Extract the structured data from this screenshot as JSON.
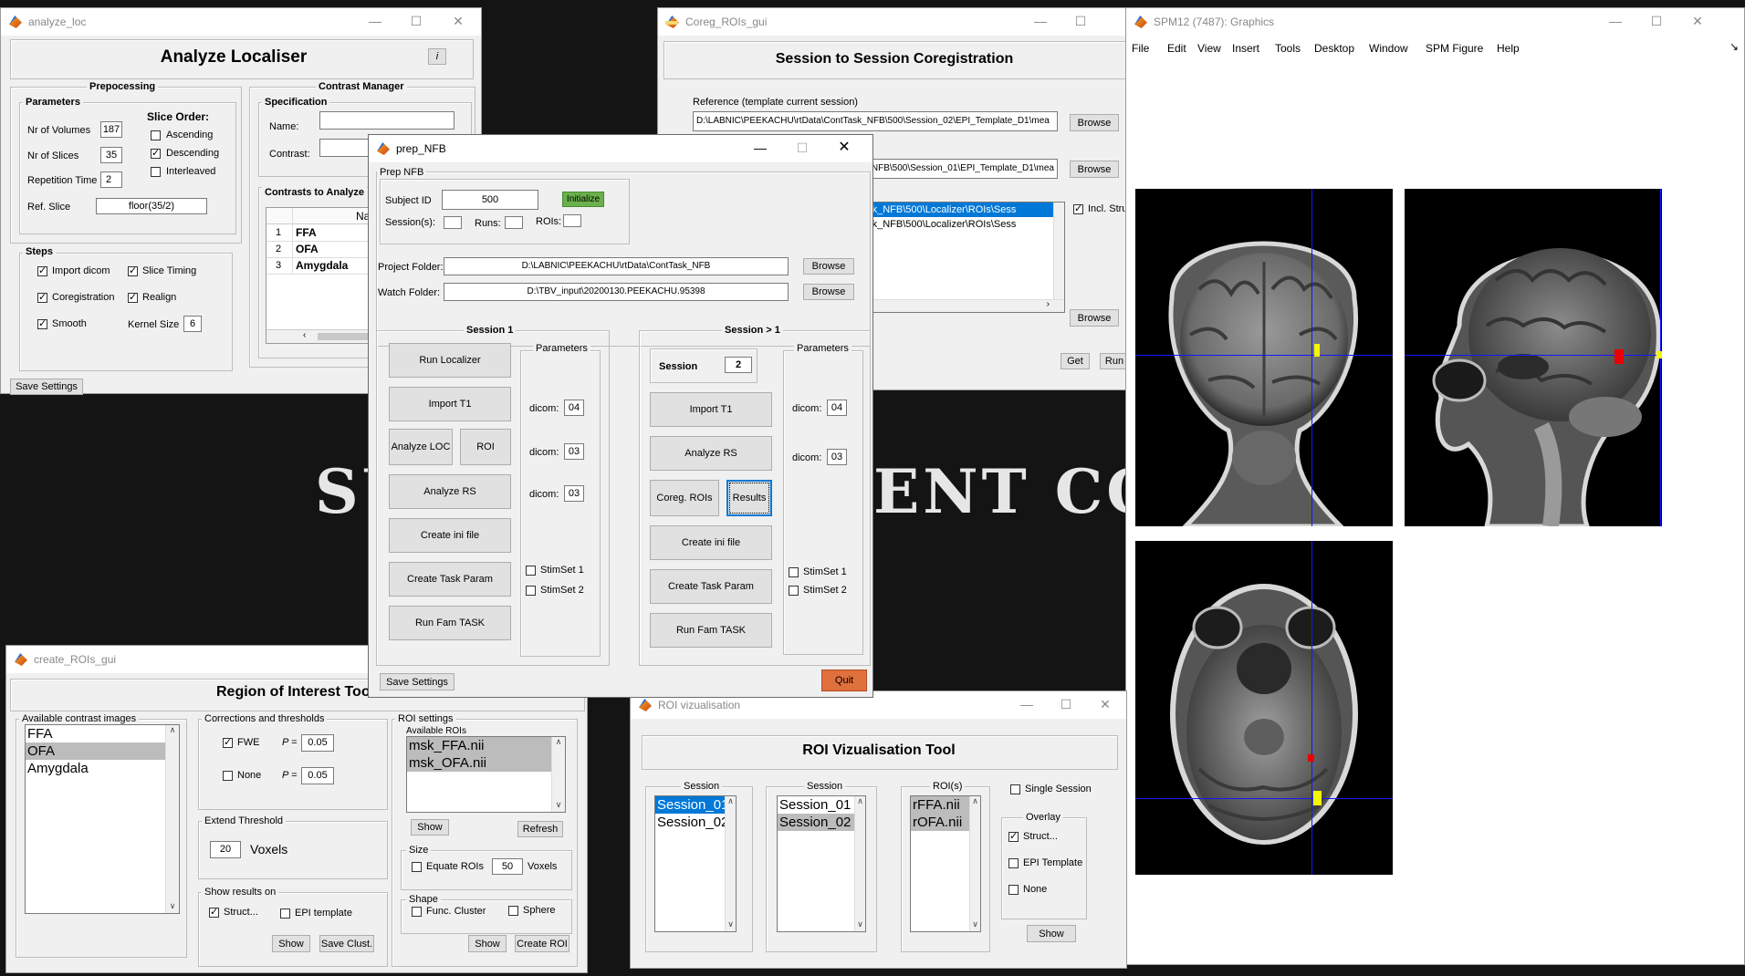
{
  "background_text": {
    "left": "SU",
    "right": "ENT CON"
  },
  "analyze_loc": {
    "window_title": "analyze_loc",
    "heading": "Analyze Localiser",
    "info_label": "i",
    "preprocessing": {
      "title": "Prepocessing",
      "parameters_title": "Parameters",
      "nr_volumes_label": "Nr of Volumes",
      "nr_volumes": "187",
      "nr_slices_label": "Nr of Slices",
      "nr_slices": "35",
      "tr_label": "Repetition Time",
      "tr": "2",
      "ref_slice_label": "Ref. Slice",
      "ref_slice": "floor(35/2)",
      "slice_order_title": "Slice Order:",
      "ascending": "Ascending",
      "descending": "Descending",
      "interleaved": "Interleaved"
    },
    "steps": {
      "title": "Steps",
      "import_dicom": "Import dicom",
      "slice_timing": "Slice Timing",
      "coregistration": "Coregistration",
      "realign": "Realign",
      "smooth": "Smooth",
      "kernel_size_label": "Kernel Size",
      "kernel_size": "6"
    },
    "contrast_manager": {
      "title": "Contrast Manager",
      "specification": "Specification",
      "name_label": "Name:",
      "contrast_label": "Contrast:",
      "table_title": "Contrasts to Analyze",
      "col_name": "Name",
      "rows": [
        {
          "n": "1",
          "name": "FFA"
        },
        {
          "n": "2",
          "name": "OFA"
        },
        {
          "n": "3",
          "name": "Amygdala"
        }
      ]
    },
    "save_settings": "Save Settings"
  },
  "coreg": {
    "window_title": "Coreg_ROIs_gui",
    "heading": "Session to Session Coregistration",
    "reference_label": "Reference (template current session)",
    "reference_path": "D:\\LABNIC\\PEEKACHU\\rtData\\ContTask_NFB\\500\\Session_02\\EPI_Template_D1\\mea",
    "second_path": "NFB\\500\\Session_01\\EPI_Template_D1\\mea",
    "browse": "Browse",
    "rois": [
      "ask_NFB\\500\\Localizer\\ROIs\\Sess",
      "ask_NFB\\500\\Localizer\\ROIs\\Sess"
    ],
    "incl_struct": "Incl. Stru",
    "get": "Get",
    "run": "Run"
  },
  "prep_nfb": {
    "window_title": "prep_NFB",
    "prep_title": "Prep NFB",
    "subject_id_label": "Subject ID",
    "subject_id": "500",
    "initialize": "Initialize",
    "sessions_label": "Session(s):",
    "runs_label": "Runs:",
    "rois_label": "ROIs:",
    "project_folder_label": "Project Folder:",
    "project_folder": "D:\\LABNIC\\PEEKACHU\\rtData\\ContTask_NFB",
    "watch_folder_label": "Watch Folder:",
    "watch_folder": "D:\\TBV_input\\20200130.PEEKACHU.95398",
    "browse": "Browse",
    "session1": {
      "title": "Session 1",
      "run_localizer": "Run Localizer",
      "import_t1": "Import T1",
      "analyze_loc": "Analyze LOC",
      "roi": "ROI",
      "analyze_rs": "Analyze RS",
      "create_ini": "Create ini file",
      "create_task_param": "Create Task Param",
      "run_fam_task": "Run Fam TASK",
      "params_title": "Parameters",
      "dicom_label": "dicom:",
      "dicom1": "04",
      "dicom2": "03",
      "dicom3": "03",
      "stimset1": "StimSet 1",
      "stimset2": "StimSet 2"
    },
    "session_gt1": {
      "title": "Session > 1",
      "session_label": "Session",
      "session_value": "2",
      "import_t1": "Import T1",
      "analyze_rs": "Analyze RS",
      "coreg_rois": "Coreg. ROIs",
      "results": "Results",
      "create_ini": "Create ini file",
      "create_task_param": "Create Task Param",
      "run_fam_task": "Run Fam TASK",
      "params_title": "Parameters",
      "dicom_label": "dicom:",
      "dicom1": "04",
      "dicom2": "03",
      "stimset1": "StimSet 1",
      "stimset2": "StimSet 2"
    },
    "save_settings": "Save Settings",
    "quit": "Quit",
    "colors": {
      "initialize": "#6ab04c",
      "quit": "#e0703c"
    }
  },
  "create_rois": {
    "window_title": "create_ROIs_gui",
    "heading": "Region of Interest Too",
    "available_contrasts_title": "Available contrast images",
    "contrasts": [
      "FFA",
      "OFA",
      "Amygdala"
    ],
    "corrections_title": "Corrections and thresholds",
    "fwe": "FWE",
    "none": "None",
    "p_label": "P =",
    "p_fwe": "0.05",
    "p_none": "0.05",
    "extend_title": "Extend Threshold",
    "extend_value": "20",
    "voxels": "Voxels",
    "show_results_title": "Show results on",
    "struct": "Struct...",
    "epi_template": "EPI template",
    "show": "Show",
    "save_clust": "Save Clust.",
    "roi_settings_title": "ROI settings",
    "available_rois_title": "Available ROIs",
    "rois": [
      "msk_FFA.nii",
      "msk_OFA.nii"
    ],
    "refresh": "Refresh",
    "size_title": "Size",
    "equate_rois": "Equate ROIs",
    "size_value": "50",
    "size_voxels": "Voxels",
    "shape_title": "Shape",
    "func_cluster": "Func. Cluster",
    "sphere": "Sphere",
    "create_roi": "Create ROI"
  },
  "roi_viz": {
    "window_title": "ROI vizualisation",
    "heading": "ROI Vizualisation Tool",
    "session_title": "Session",
    "sessions_a": [
      "Session_01",
      "Session_02"
    ],
    "sessions_b": [
      "Session_01",
      "Session_02"
    ],
    "rois_title": "ROI(s)",
    "rois": [
      "rFFA.nii",
      "rOFA.nii"
    ],
    "single_session": "Single Session",
    "overlay_title": "Overlay",
    "struct": "Struct...",
    "epi_template": "EPI Template",
    "none": "None",
    "show": "Show"
  },
  "spm": {
    "window_title": "SPM12 (7487): Graphics",
    "menu": [
      "File",
      "Edit",
      "View",
      "Insert",
      "Tools",
      "Desktop",
      "Window",
      "SPM Figure",
      "Help"
    ]
  }
}
